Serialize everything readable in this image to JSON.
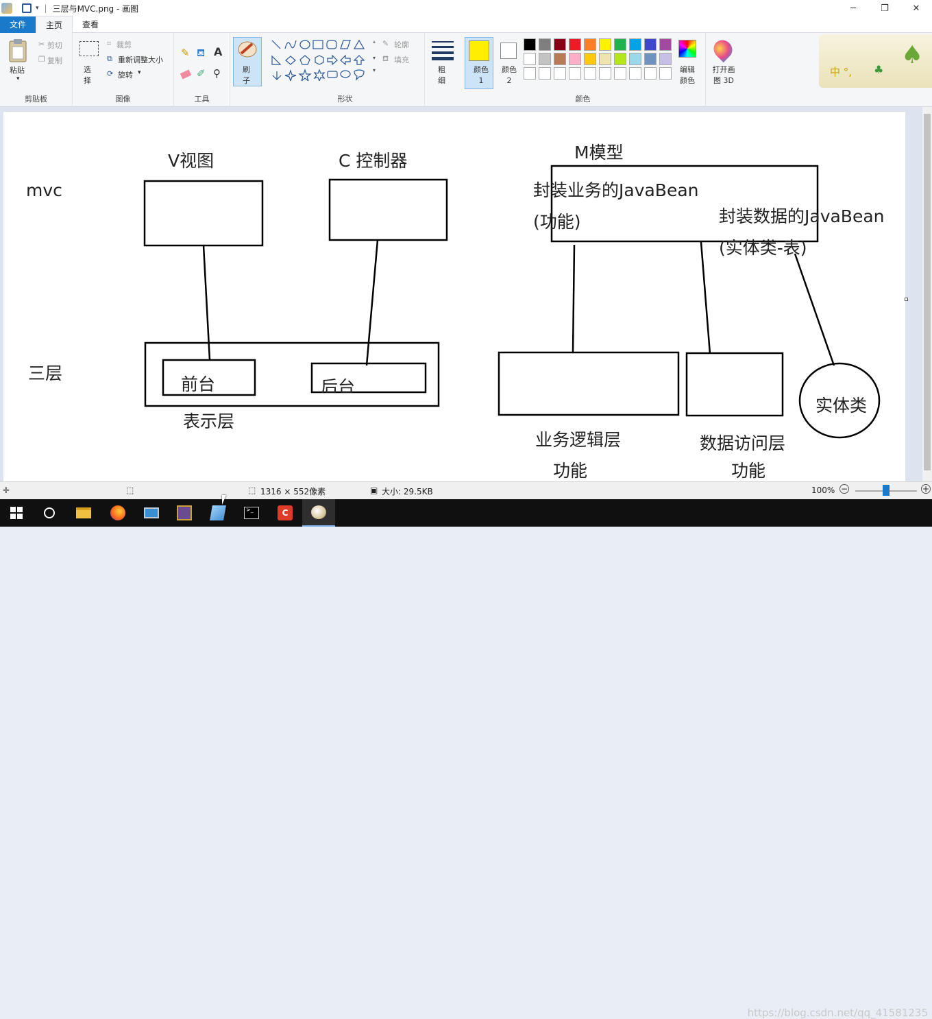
{
  "window": {
    "title": "三层与MVC.png - 画图",
    "controls": [
      "─",
      "❐",
      "✕"
    ]
  },
  "tabs": [
    {
      "label": "文件"
    },
    {
      "label": "主页"
    },
    {
      "label": "查看"
    }
  ],
  "ribbon": {
    "clipboard": {
      "paste": "粘贴",
      "cut": "剪切",
      "copy": "复制",
      "group": "剪贴板"
    },
    "image": {
      "select": "选择",
      "crop": "裁剪",
      "resize": "重新调整大小",
      "rotate": "旋转",
      "group": "图像"
    },
    "tools": {
      "group": "工具",
      "brush": "刷子"
    },
    "shapes": {
      "outline": "轮廓",
      "fill": "填充",
      "group": "形状"
    },
    "size": {
      "label": "粗细"
    },
    "colors": {
      "color1": "颜色 1",
      "color2": "颜色 2",
      "edit": "编辑颜色",
      "group": "颜色",
      "color1_value": "#ffee00",
      "color2_value": "#ffffff",
      "palette": [
        "#000000",
        "#7f7f7f",
        "#880015",
        "#ed1c24",
        "#ff7f27",
        "#fff200",
        "#22b14c",
        "#00a2e8",
        "#3f48cc",
        "#a349a4",
        "#ffffff",
        "#c3c3c3",
        "#b97a57",
        "#ffaec9",
        "#ffc90e",
        "#efe4b0",
        "#b5e61d",
        "#99d9ea",
        "#7092be",
        "#c8bfe7"
      ]
    },
    "paint3d": "打开画图 3D"
  },
  "canvas": {
    "mvc_label": "mvc",
    "v_label": "V视图",
    "c_label": "C 控制器",
    "m_label": "M模型",
    "biz_bean": "封装业务的JavaBean",
    "biz_bean_sub": "(功能)",
    "data_bean": "封装数据的JavaBean",
    "data_bean_sub": "(实体类-表)",
    "three_layer": "三层",
    "front": "前台",
    "back": "后台",
    "presentation": "表示层",
    "business": "业务逻辑层",
    "business_sub": "功能",
    "data_access": "数据访问层",
    "data_access_sub": "功能",
    "entity": "实体类"
  },
  "status": {
    "dimensions": "1316 × 552像素",
    "size": "大小: 29.5KB",
    "zoom": "100%"
  },
  "taskbar": {
    "watermark": "https://blog.csdn.net/qq_41581235"
  }
}
